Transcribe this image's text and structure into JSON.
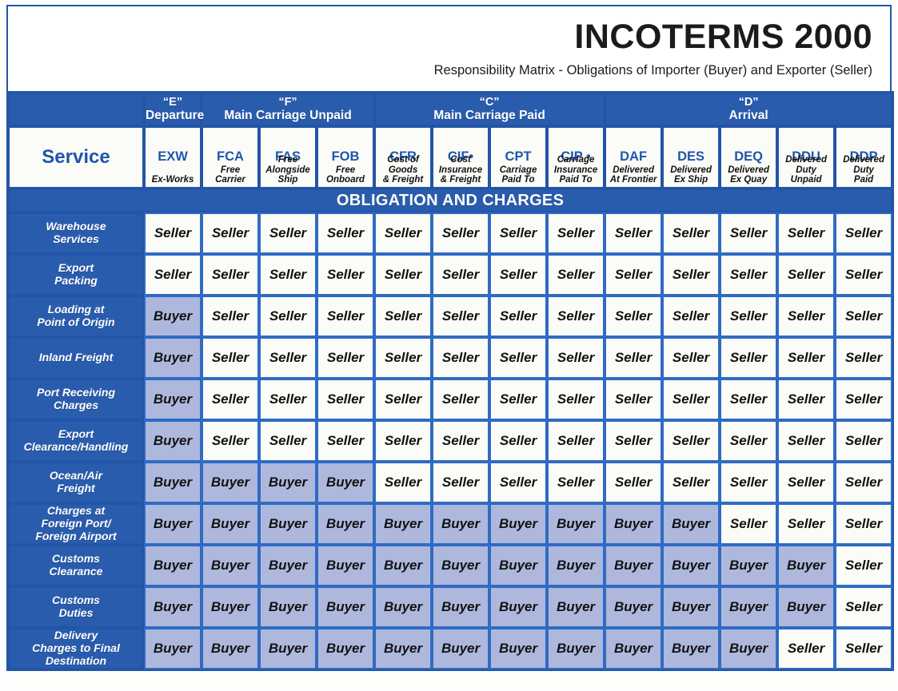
{
  "title": {
    "main": "INCOTERMS 2000",
    "subtitle": "Responsibility Matrix - Obligations of Importer (Buyer) and Exporter (Seller)"
  },
  "colors": {
    "header_blue": "#2a5cad",
    "border_blue": "#2255a8",
    "cell_border": "#2f6bc4",
    "buyer_fill": "#aeb8dd",
    "seller_fill": "#fbfbf8",
    "code_text": "#1f56ac"
  },
  "service_header": "Service",
  "obligation_banner": "OBLIGATION AND CHARGES",
  "groups": [
    {
      "letter": "“E”",
      "name": "Departure",
      "span": 1
    },
    {
      "letter": "“F”",
      "name": "Main Carriage Unpaid",
      "span": 3
    },
    {
      "letter": "“C”",
      "name": "Main Carriage Paid",
      "span": 4
    },
    {
      "letter": "“D”",
      "name": "Arrival",
      "span": 5
    }
  ],
  "columns": [
    {
      "code": "EXW",
      "expansion": "Ex-Works"
    },
    {
      "code": "FCA",
      "expansion": "Free\nCarrier"
    },
    {
      "code": "FAS",
      "expansion": "Free\nAlongside\nShip"
    },
    {
      "code": "FOB",
      "expansion": "Free\nOnboard"
    },
    {
      "code": "CFR",
      "expansion": "Cost of\nGoods\n& Freight"
    },
    {
      "code": "CIF•",
      "expansion": "Cost\nInsurance\n& Freight"
    },
    {
      "code": "CPT",
      "expansion": "Carriage\nPaid To"
    },
    {
      "code": "CIP •",
      "expansion": "Carriage\nInsurance\nPaid To"
    },
    {
      "code": "DAF",
      "expansion": "Delivered\nAt Frontier"
    },
    {
      "code": "DES",
      "expansion": "Delivered\nEx Ship"
    },
    {
      "code": "DEQ",
      "expansion": "Delivered\nEx Quay"
    },
    {
      "code": "DDU",
      "expansion": "Delivered\nDuty\nUnpaid"
    },
    {
      "code": "DDP",
      "expansion": "Delivered\nDuty\nPaid"
    }
  ],
  "rows": [
    {
      "label": "Warehouse\nServices",
      "values": [
        "Seller",
        "Seller",
        "Seller",
        "Seller",
        "Seller",
        "Seller",
        "Seller",
        "Seller",
        "Seller",
        "Seller",
        "Seller",
        "Seller",
        "Seller"
      ]
    },
    {
      "label": "Export\nPacking",
      "values": [
        "Seller",
        "Seller",
        "Seller",
        "Seller",
        "Seller",
        "Seller",
        "Seller",
        "Seller",
        "Seller",
        "Seller",
        "Seller",
        "Seller",
        "Seller"
      ]
    },
    {
      "label": "Loading at\nPoint of Origin",
      "values": [
        "Buyer",
        "Seller",
        "Seller",
        "Seller",
        "Seller",
        "Seller",
        "Seller",
        "Seller",
        "Seller",
        "Seller",
        "Seller",
        "Seller",
        "Seller"
      ]
    },
    {
      "label": "Inland Freight",
      "values": [
        "Buyer",
        "Seller",
        "Seller",
        "Seller",
        "Seller",
        "Seller",
        "Seller",
        "Seller",
        "Seller",
        "Seller",
        "Seller",
        "Seller",
        "Seller"
      ]
    },
    {
      "label": "Port Receiving\nCharges",
      "values": [
        "Buyer",
        "Seller",
        "Seller",
        "Seller",
        "Seller",
        "Seller",
        "Seller",
        "Seller",
        "Seller",
        "Seller",
        "Seller",
        "Seller",
        "Seller"
      ]
    },
    {
      "label": "Export\nClearance/Handling",
      "values": [
        "Buyer",
        "Seller",
        "Seller",
        "Seller",
        "Seller",
        "Seller",
        "Seller",
        "Seller",
        "Seller",
        "Seller",
        "Seller",
        "Seller",
        "Seller"
      ]
    },
    {
      "label": "Ocean/Air\nFreight",
      "values": [
        "Buyer",
        "Buyer",
        "Buyer",
        "Buyer",
        "Seller",
        "Seller",
        "Seller",
        "Seller",
        "Seller",
        "Seller",
        "Seller",
        "Seller",
        "Seller"
      ]
    },
    {
      "label": "Charges at\nForeign Port/\nForeign Airport",
      "values": [
        "Buyer",
        "Buyer",
        "Buyer",
        "Buyer",
        "Buyer",
        "Buyer",
        "Buyer",
        "Buyer",
        "Buyer",
        "Buyer",
        "Seller",
        "Seller",
        "Seller"
      ]
    },
    {
      "label": "Customs\nClearance",
      "values": [
        "Buyer",
        "Buyer",
        "Buyer",
        "Buyer",
        "Buyer",
        "Buyer",
        "Buyer",
        "Buyer",
        "Buyer",
        "Buyer",
        "Buyer",
        "Buyer",
        "Seller"
      ]
    },
    {
      "label": "Customs\nDuties",
      "values": [
        "Buyer",
        "Buyer",
        "Buyer",
        "Buyer",
        "Buyer",
        "Buyer",
        "Buyer",
        "Buyer",
        "Buyer",
        "Buyer",
        "Buyer",
        "Buyer",
        "Seller"
      ]
    },
    {
      "label": "Delivery\nCharges to Final\nDestination",
      "values": [
        "Buyer",
        "Buyer",
        "Buyer",
        "Buyer",
        "Buyer",
        "Buyer",
        "Buyer",
        "Buyer",
        "Buyer",
        "Buyer",
        "Buyer",
        "Seller",
        "Seller"
      ]
    }
  ]
}
